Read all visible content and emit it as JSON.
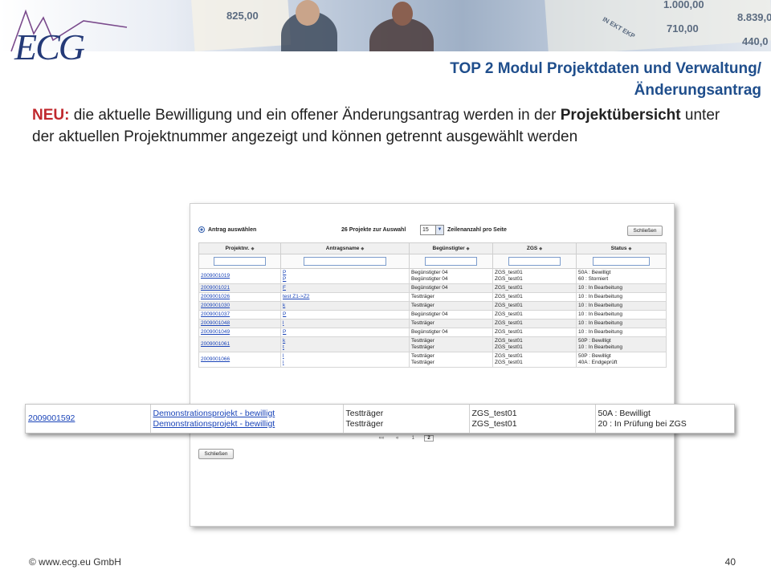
{
  "banner": {
    "numbers": [
      "825,00",
      "8.839,0",
      "710,00",
      "1.000,00",
      "440,0",
      "IN EKT EKP"
    ]
  },
  "logo": {
    "text": "ECG"
  },
  "title": {
    "line1": "TOP 2 Modul Projektdaten und Verwaltung/",
    "line2": "Änderungsantrag"
  },
  "intro": {
    "neu": "NEU:",
    "part1": " die aktuelle Bewilligung und ein offener Änderungsantrag werden in der ",
    "bold": "Projektübersicht",
    "part2": " unter der aktuellen Projektnummer angezeigt und können getrennt ausgewählt werden"
  },
  "app": {
    "select_label": "Antrag auswählen",
    "count_label": "26 Projekte zur Auswahl",
    "rows_value": "15",
    "rows_label": "Zeilenanzahl pro Seite",
    "close_top": "Schließen",
    "close_bottom": "Schließen",
    "columns": [
      "Projektnr.",
      "Antragsname",
      "Begünstigter",
      "ZGS",
      "Status"
    ],
    "rows": [
      {
        "nr": "2009001019",
        "name": [
          "P",
          "P"
        ],
        "beg": [
          "Begünstigter 04",
          "Begünstigter 04"
        ],
        "zgs": [
          "ZGS_test01",
          "ZGS_test01"
        ],
        "status": [
          "50A : Bewilligt",
          "60 : Storniert"
        ]
      },
      {
        "nr": "2009001021",
        "name": [
          "F"
        ],
        "beg": [
          "Begünstigter 04"
        ],
        "zgs": [
          "ZGS_test01"
        ],
        "status": [
          "10 : In Bearbeitung"
        ]
      },
      {
        "nr": "2009001026",
        "name": [
          "test Z1->Z2"
        ],
        "beg": [
          "Testträger"
        ],
        "zgs": [
          "ZGS_test01"
        ],
        "status": [
          "10 : In Bearbeitung"
        ]
      },
      {
        "nr": "2009001030",
        "name": [
          "k"
        ],
        "beg": [
          "Testträger"
        ],
        "zgs": [
          "ZGS_test01"
        ],
        "status": [
          "10 : In Bearbeitung"
        ]
      },
      {
        "nr": "2009001037",
        "name": [
          "P"
        ],
        "beg": [
          "Begünstigter 04"
        ],
        "zgs": [
          "ZGS_test01"
        ],
        "status": [
          "10 : In Bearbeitung"
        ]
      },
      {
        "nr": "2009001048",
        "name": [
          "l"
        ],
        "beg": [
          "Testträger"
        ],
        "zgs": [
          "ZGS_test01"
        ],
        "status": [
          "10 : In Bearbeitung"
        ]
      },
      {
        "nr": "2009001049",
        "name": [
          "P"
        ],
        "beg": [
          "Begünstigter 04"
        ],
        "zgs": [
          "ZGS_test01"
        ],
        "status": [
          "10 : In Bearbeitung"
        ]
      },
      {
        "nr": "2009001061",
        "name": [
          "k",
          "t"
        ],
        "beg": [
          "Testträger",
          "Testträger"
        ],
        "zgs": [
          "ZGS_test01",
          "ZGS_test01"
        ],
        "status": [
          "50P : Bewilligt",
          "10 : In Bearbeitung"
        ]
      },
      {
        "nr": "2009001066",
        "name": [
          "l",
          "i"
        ],
        "beg": [
          "Testträger",
          "Testträger"
        ],
        "zgs": [
          "ZGS_test01",
          "ZGS_test01"
        ],
        "status": [
          "50P : Bewilligt",
          "40A : Endgeprüft"
        ]
      }
    ],
    "pager": [
      "««",
      "«",
      "1",
      "2"
    ]
  },
  "highlight": {
    "nr": "2009001592",
    "name1": "Demonstrationsprojekt - bewilligt",
    "name2": "Demonstrationsprojekt - bewilligt",
    "beg1": "Testträger",
    "beg2": "Testträger",
    "zgs1": "ZGS_test01",
    "zgs2": "ZGS_test01",
    "status1": "50A : Bewilligt",
    "status2": "20 : In Prüfung bei ZGS"
  },
  "footer": {
    "left": "© www.ecg.eu GmbH",
    "page": "40"
  }
}
